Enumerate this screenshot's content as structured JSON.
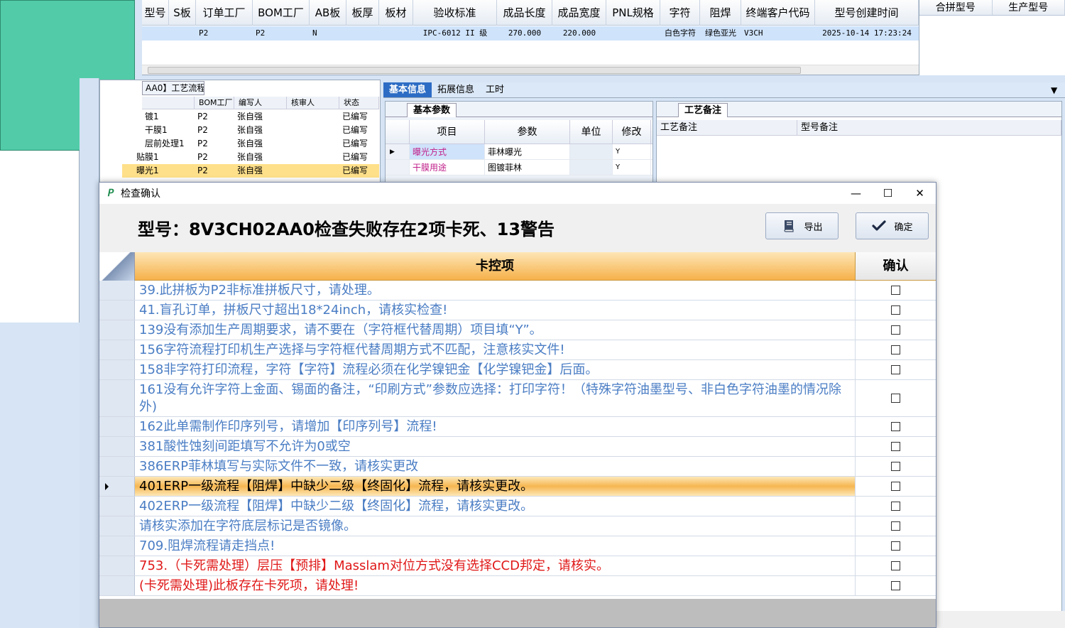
{
  "background": {
    "top_grid": {
      "headers": [
        "型号",
        "S板",
        "订单工厂",
        "BOM工厂",
        "AB板",
        "板厚",
        "板材",
        "验收标准",
        "成品长度",
        "成品宽度",
        "PNL规格",
        "字符",
        "阻焊",
        "终端客户代码",
        "型号创建时间"
      ],
      "row": [
        "",
        "",
        "P2",
        "P2",
        "N",
        "",
        "",
        "IPC-6012 II 级",
        "270.000",
        "220.000",
        "",
        "白色字符",
        "绿色亚光",
        "V3CH",
        "2025-10-14 17:23:24"
      ]
    },
    "right_panel": {
      "headers": [
        "合拼型号",
        "生产型号"
      ]
    },
    "tree": {
      "tab": "AA0】工艺流程",
      "headers": [
        "",
        "BOM工厂",
        "编写人",
        "核审人",
        "状态"
      ],
      "rows": [
        {
          "name": "镀1",
          "factory": "P2",
          "author": "张自强",
          "status": "已编写"
        },
        {
          "name": "干膜1",
          "factory": "P2",
          "author": "张自强",
          "status": "已编写"
        },
        {
          "name": "层前处理1",
          "factory": "P2",
          "author": "张自强",
          "status": "已编写"
        },
        {
          "name": "贴膜1",
          "factory": "P2",
          "author": "张自强",
          "status": "已编写"
        },
        {
          "name": "曝光1",
          "factory": "P2",
          "author": "张自强",
          "status": "已编写"
        }
      ]
    },
    "mid_tabs": [
      "基本信息",
      "拓展信息",
      "工时"
    ],
    "basic": {
      "subtab": "基本参数",
      "headers": [
        "项目",
        "参数",
        "单位",
        "修改"
      ],
      "rows": [
        {
          "item": "曝光方式",
          "param": "菲林曝光",
          "unit": "",
          "edit": "Y"
        },
        {
          "item": "干膜用途",
          "param": "图镀菲林",
          "unit": "",
          "edit": "Y"
        }
      ]
    },
    "remark": {
      "subtab": "工艺备注",
      "headers": [
        "工艺备注",
        "型号备注"
      ]
    }
  },
  "dialog": {
    "title": "检查确认",
    "heading": "型号：8V3CH02AA0检查失败存在2项卡死、13警告",
    "export_label": "导出",
    "confirm_label": "确定",
    "col_main": "卡控项",
    "col_confirm": "确认",
    "colors": {
      "warn": "#4a7dc4",
      "error": "#e01818",
      "header": "#f6b14a"
    },
    "rows": [
      {
        "text": "39.此拼板为P2非标准拼板尺寸，请处理。",
        "level": "warn"
      },
      {
        "text": "41.盲孔订单，拼板尺寸超出18*24inch，请核实检查!",
        "level": "warn"
      },
      {
        "text": "139没有添加生产周期要求，请不要在（字符框代替周期）项目填“Y”。",
        "level": "warn"
      },
      {
        "text": "156字符流程打印机生产选择与字符框代替周期方式不匹配，注意核实文件!",
        "level": "warn"
      },
      {
        "text": "158非字符打印流程，字符【字符】流程必须在化学镍钯金【化学镍钯金】后面。",
        "level": "warn"
      },
      {
        "text": "161没有允许字符上金面、锡面的备注，“印刷方式”参数应选择：打印字符！（特殊字符油墨型号、非白色字符油墨的情况除外)",
        "level": "warn",
        "tall": true
      },
      {
        "text": "162此单需制作印序列号，请增加【印序列号】流程!",
        "level": "warn"
      },
      {
        "text": "381酸性蚀刻间距填写不允许为0或空",
        "level": "warn"
      },
      {
        "text": "386ERP菲林填写与实际文件不一致，请核实更改",
        "level": "warn"
      },
      {
        "text": "401ERP一级流程【阻焊】中缺少二级【终固化】流程，请核实更改。",
        "level": "warn",
        "selected": true
      },
      {
        "text": "402ERP一级流程【阻焊】中缺少二级【终固化】流程，请核实更改。",
        "level": "warn"
      },
      {
        "text": "请核实添加在字符底层标记是否镜像。",
        "level": "warn"
      },
      {
        "text": "709.阻焊流程请走挡点!",
        "level": "warn"
      },
      {
        "text": "753.（卡死需处理）层压【预排】Masslam对位方式没有选择CCD邦定，请核实。",
        "level": "error"
      },
      {
        "text": "(卡死需处理)此板存在卡死项，请处理!",
        "level": "error"
      }
    ]
  }
}
